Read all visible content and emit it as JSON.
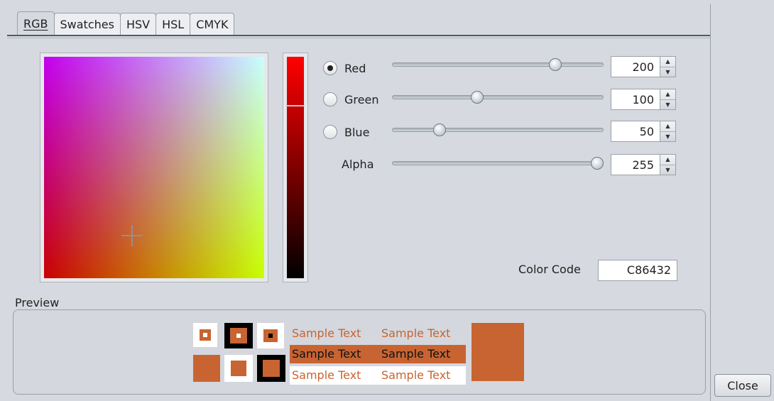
{
  "tabs": [
    {
      "label": "RGB",
      "active": true
    },
    {
      "label": "Swatches",
      "active": false
    },
    {
      "label": "HSV",
      "active": false
    },
    {
      "label": "HSL",
      "active": false
    },
    {
      "label": "CMYK",
      "active": false
    }
  ],
  "sliders": {
    "red": {
      "label": "Red",
      "value": "200",
      "selected": true
    },
    "green": {
      "label": "Green",
      "value": "100",
      "selected": false
    },
    "blue": {
      "label": "Blue",
      "value": "50",
      "selected": false
    },
    "alpha": {
      "label": "Alpha",
      "value": "255"
    }
  },
  "color_code": {
    "label": "Color Code",
    "value": "C86432"
  },
  "preview": {
    "label": "Preview",
    "sample_text": "Sample Text",
    "color": "#c86432"
  },
  "close_label": "Close",
  "colors": {
    "selected": "#c86432",
    "panel": "#d6d9df"
  }
}
